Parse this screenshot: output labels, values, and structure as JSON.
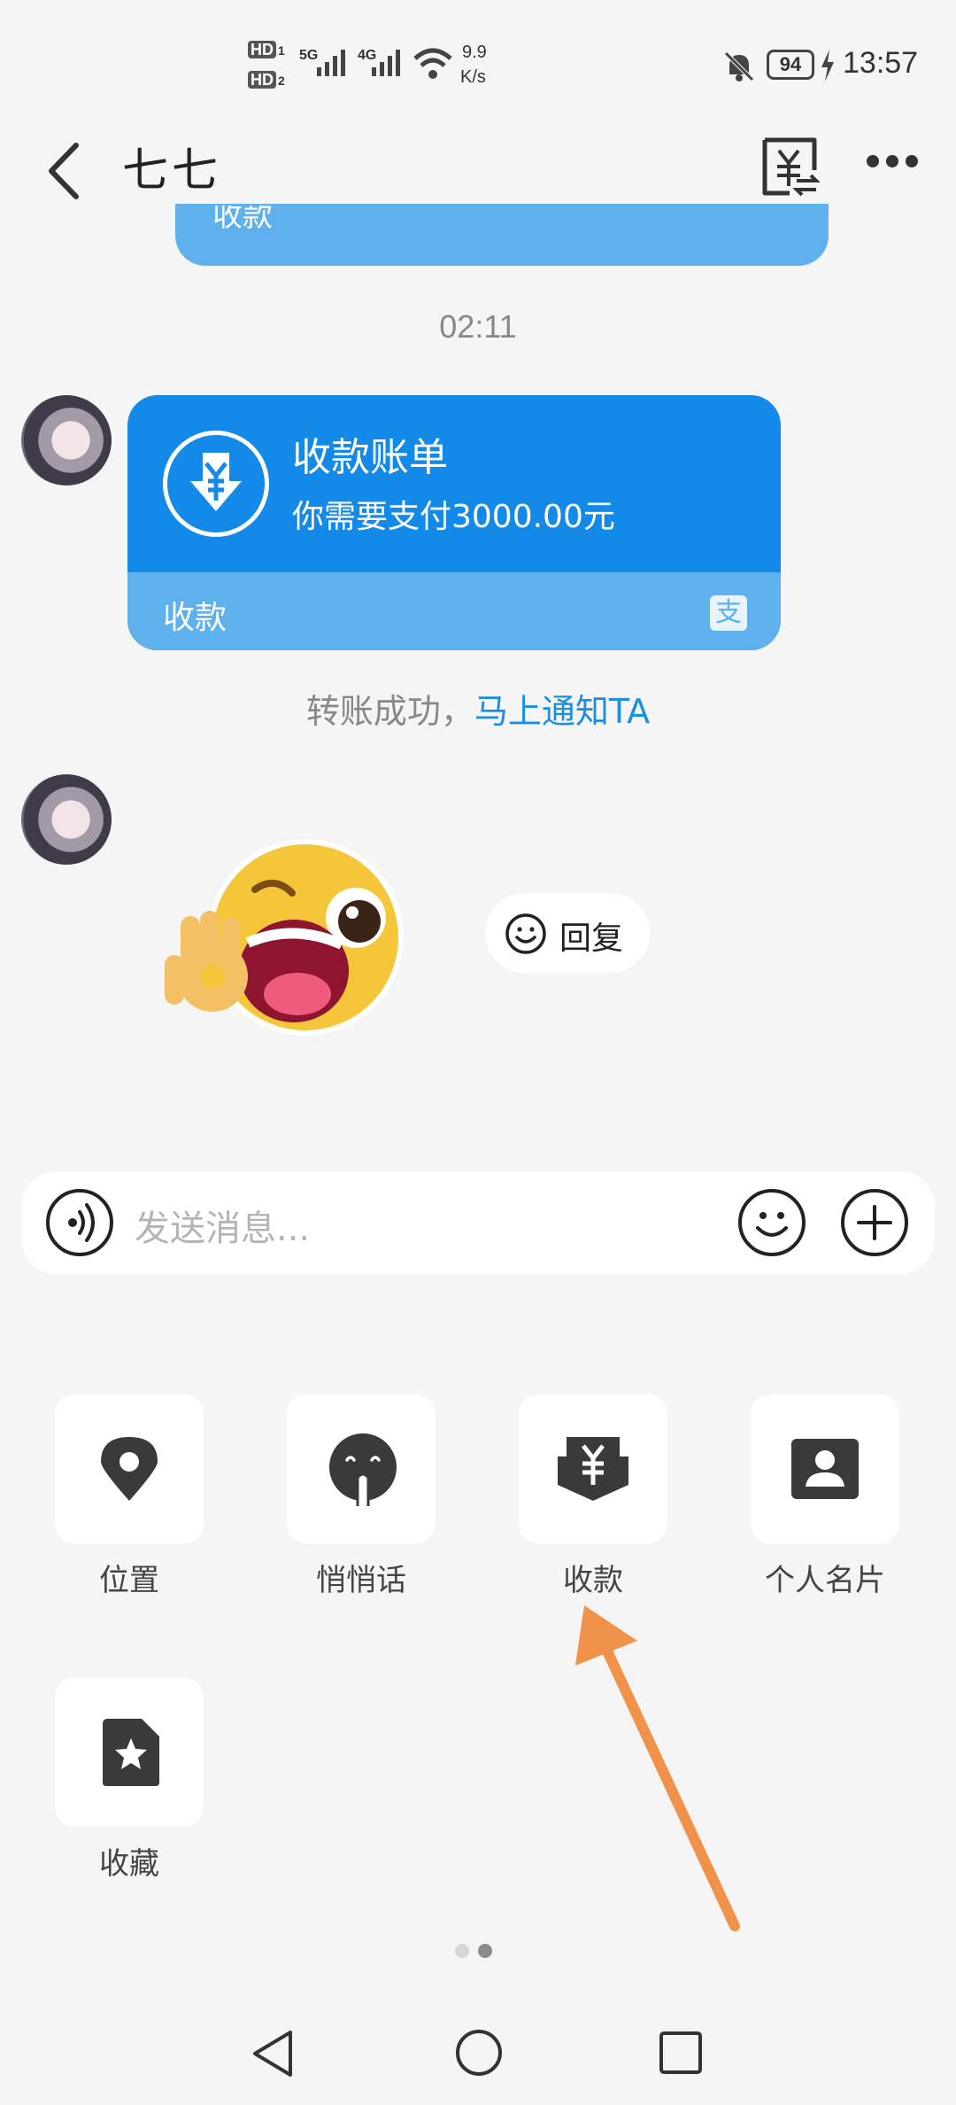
{
  "status_bar": {
    "hd1": "HD",
    "sim1": "1",
    "hd2": "HD",
    "sim2": "2",
    "net1": "5G",
    "net2": "4G",
    "speed_value": "9.9",
    "speed_unit": "K/s",
    "battery": "94",
    "time": "13:57"
  },
  "header": {
    "title": "七七",
    "back_icon": "back-icon",
    "transfer_icon": "yuan-transfer-icon",
    "more_icon": "more-icon"
  },
  "chat": {
    "partial_card_label": "收款",
    "timestamp": "02:11",
    "payment_card": {
      "title": "收款账单",
      "subtitle": "你需要支付3000.00元",
      "footer_label": "收款",
      "badge": "支"
    },
    "notice_text": "转账成功，",
    "notice_link": "马上通知TA",
    "reply_label": "回复"
  },
  "input": {
    "placeholder": "发送消息..."
  },
  "panel": {
    "items": [
      {
        "label": "位置",
        "icon": "location-pin-icon"
      },
      {
        "label": "悄悄话",
        "icon": "whisper-icon"
      },
      {
        "label": "收款",
        "icon": "receive-payment-icon"
      },
      {
        "label": "个人名片",
        "icon": "contact-card-icon"
      },
      {
        "label": "收藏",
        "icon": "favorite-file-icon"
      }
    ],
    "page_count": 2,
    "current_page": 2
  },
  "colors": {
    "accent_blue": "#1389e8",
    "light_blue": "#5fb1ee",
    "link_blue": "#1a8fe0",
    "arrow_orange": "#f0924a"
  }
}
